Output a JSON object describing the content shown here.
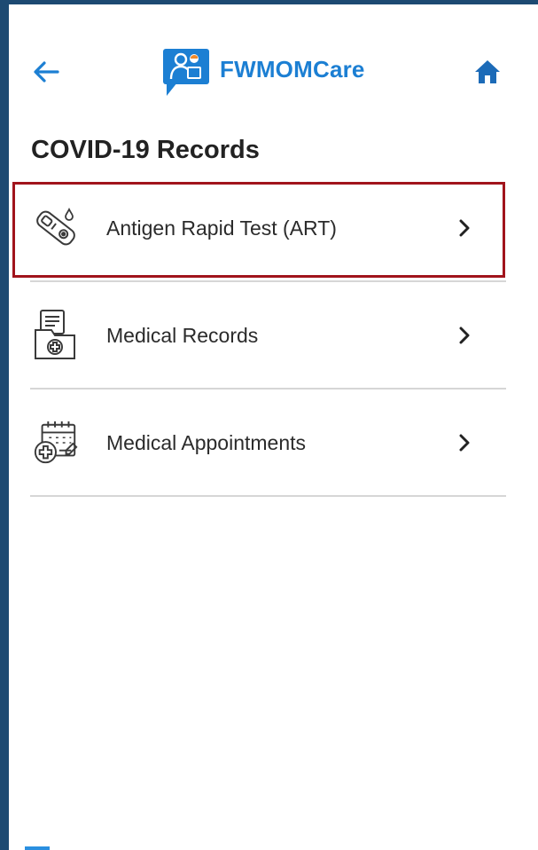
{
  "app": {
    "brand_name": "FWMOMCare",
    "brand_color": "#1c7fd3",
    "frame_color": "#1d4a72"
  },
  "header": {
    "back_icon": "arrow-left-icon",
    "home_icon": "home-icon",
    "logo_icon": "fwmomcare-logo-icon"
  },
  "page": {
    "title": "COVID-19 Records"
  },
  "menu": {
    "items": [
      {
        "label": "Antigen Rapid Test (ART)",
        "icon": "test-kit-icon",
        "highlighted": true
      },
      {
        "label": "Medical Records",
        "icon": "medical-records-icon",
        "highlighted": false
      },
      {
        "label": "Medical Appointments",
        "icon": "medical-appointment-calendar-icon",
        "highlighted": false
      }
    ]
  },
  "highlight_color": "#a1141c"
}
